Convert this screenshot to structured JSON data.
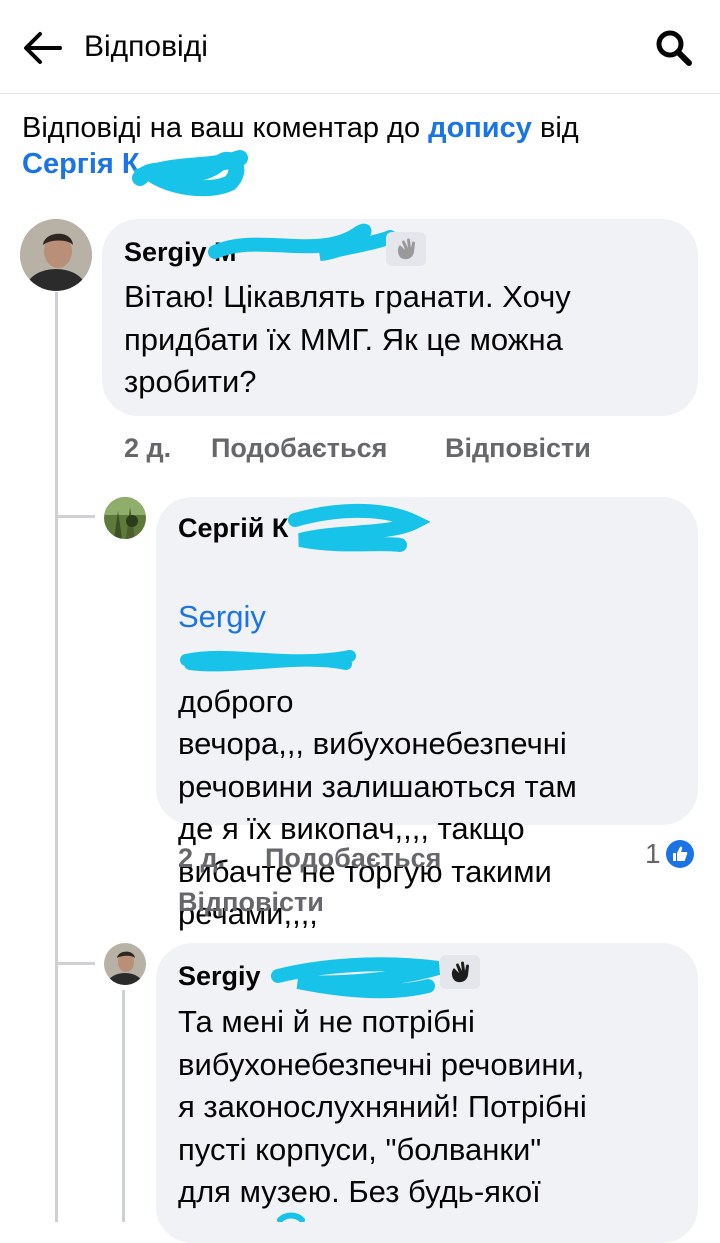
{
  "header": {
    "title": "Відповіді"
  },
  "context": {
    "prefix": "Відповіді на ваш коментар до ",
    "post_link": "допису",
    "middle": " від",
    "author_link": "Сергія К"
  },
  "comments": [
    {
      "author": "Sergiy M",
      "text": "Вітаю! Цікавлять гранати. Хочу\nпридбати їх ММГ. Як це можна\nзробити?",
      "time": "2 д.",
      "like_label": "Подобається",
      "reply_label": "Відповісти"
    },
    {
      "author": "Сергій К",
      "mention": "Sergiy",
      "text": "доброго\nвечора,,, вибухонебезпечні\nречовини залишаються там\nде я їх викопач,,,, такщо\nвибачте не торгую такими\nречами,,,,",
      "time": "2 д.",
      "like_label": "Подобається",
      "reply_label": "Відповісти",
      "reaction_count": "1"
    },
    {
      "author": "Sergiy",
      "text": "Та мені й не потрібні\nвибухонебезпечні речовини,\nя законослухняний! Потрібні\nпусті корпуси, \"болванки\"\nдля музею. Без будь-якої"
    }
  ],
  "colors": {
    "link": "#1b74e4",
    "bubble": "#f0f2f5",
    "meta": "#65676b",
    "thread_line": "#ced0d4",
    "redaction": "#17c3e8"
  },
  "icons": [
    "back-arrow-icon",
    "search-icon",
    "wave-hand-icon",
    "like-icon"
  ]
}
